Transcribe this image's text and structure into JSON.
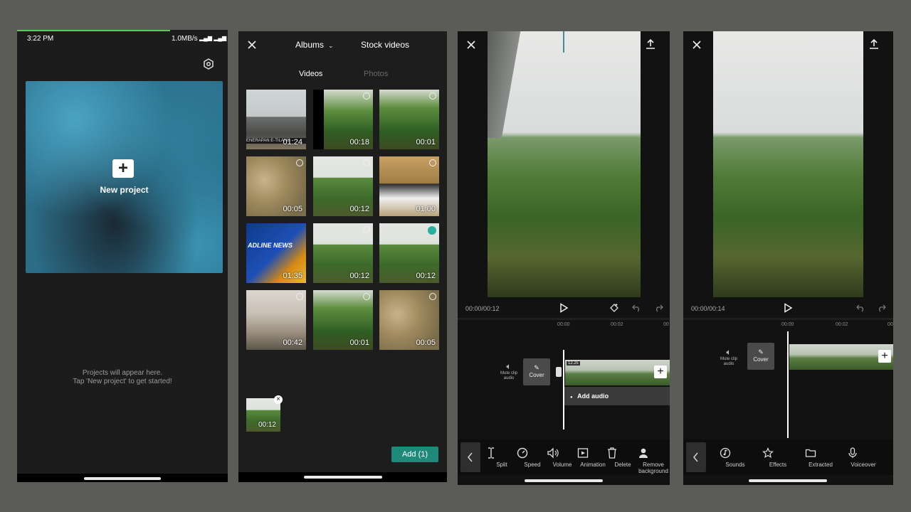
{
  "screen1": {
    "time": "3:22 PM",
    "network": "1.0MB/s",
    "new_project": "New project",
    "empty_line1": "Projects will appear here.",
    "empty_line2": "Tap 'New project' to get started!"
  },
  "screen2": {
    "albums": "Albums",
    "stock": "Stock videos",
    "tab_videos": "Videos",
    "tab_photos": "Photos",
    "thumbs": [
      {
        "duration": "01:24",
        "caption": "ENERAPAN E-TILANG"
      },
      {
        "duration": "00:18"
      },
      {
        "duration": "00:01"
      },
      {
        "duration": "00:05"
      },
      {
        "duration": "00:12"
      },
      {
        "duration": "01:00"
      },
      {
        "duration": "01:35",
        "caption": "ADLINE NEWS"
      },
      {
        "duration": "00:12"
      },
      {
        "duration": "00:12"
      },
      {
        "duration": "00:42"
      },
      {
        "duration": "00:01"
      },
      {
        "duration": "00:05"
      }
    ],
    "selected_duration": "00:12",
    "add_button": "Add (1)"
  },
  "screen3": {
    "timecode": "00:00/00:12",
    "tick1": "00:00",
    "tick2": "00:02",
    "tick3": "00",
    "mute_label": "Mute clip audio",
    "cover": "Cover",
    "clip_badge": "12.2s",
    "add_audio": "Add audio",
    "tools": [
      "Split",
      "Speed",
      "Volume",
      "Animation",
      "Delete",
      "Remove background"
    ]
  },
  "screen4": {
    "timecode": "00:00/00:14",
    "tick1": "00:00",
    "tick2": "00:02",
    "tick3": "00",
    "mute_label": "Mute clip audio",
    "cover": "Cover",
    "tools": [
      "Sounds",
      "Effects",
      "Extracted",
      "Voiceover"
    ]
  },
  "colors": {
    "background": "#5b5c58",
    "accent_teal": "#1f8a7a",
    "progress_green": "#5ac85a"
  }
}
